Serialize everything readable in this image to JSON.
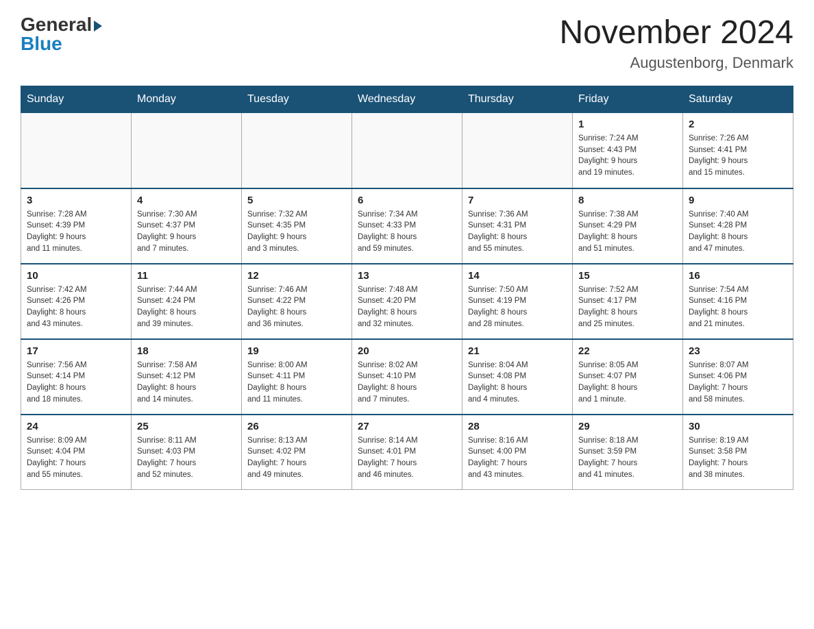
{
  "header": {
    "logo_general": "General",
    "logo_blue": "Blue",
    "month_title": "November 2024",
    "location": "Augustenborg, Denmark"
  },
  "weekdays": [
    "Sunday",
    "Monday",
    "Tuesday",
    "Wednesday",
    "Thursday",
    "Friday",
    "Saturday"
  ],
  "weeks": [
    [
      {
        "day": "",
        "info": ""
      },
      {
        "day": "",
        "info": ""
      },
      {
        "day": "",
        "info": ""
      },
      {
        "day": "",
        "info": ""
      },
      {
        "day": "",
        "info": ""
      },
      {
        "day": "1",
        "info": "Sunrise: 7:24 AM\nSunset: 4:43 PM\nDaylight: 9 hours\nand 19 minutes."
      },
      {
        "day": "2",
        "info": "Sunrise: 7:26 AM\nSunset: 4:41 PM\nDaylight: 9 hours\nand 15 minutes."
      }
    ],
    [
      {
        "day": "3",
        "info": "Sunrise: 7:28 AM\nSunset: 4:39 PM\nDaylight: 9 hours\nand 11 minutes."
      },
      {
        "day": "4",
        "info": "Sunrise: 7:30 AM\nSunset: 4:37 PM\nDaylight: 9 hours\nand 7 minutes."
      },
      {
        "day": "5",
        "info": "Sunrise: 7:32 AM\nSunset: 4:35 PM\nDaylight: 9 hours\nand 3 minutes."
      },
      {
        "day": "6",
        "info": "Sunrise: 7:34 AM\nSunset: 4:33 PM\nDaylight: 8 hours\nand 59 minutes."
      },
      {
        "day": "7",
        "info": "Sunrise: 7:36 AM\nSunset: 4:31 PM\nDaylight: 8 hours\nand 55 minutes."
      },
      {
        "day": "8",
        "info": "Sunrise: 7:38 AM\nSunset: 4:29 PM\nDaylight: 8 hours\nand 51 minutes."
      },
      {
        "day": "9",
        "info": "Sunrise: 7:40 AM\nSunset: 4:28 PM\nDaylight: 8 hours\nand 47 minutes."
      }
    ],
    [
      {
        "day": "10",
        "info": "Sunrise: 7:42 AM\nSunset: 4:26 PM\nDaylight: 8 hours\nand 43 minutes."
      },
      {
        "day": "11",
        "info": "Sunrise: 7:44 AM\nSunset: 4:24 PM\nDaylight: 8 hours\nand 39 minutes."
      },
      {
        "day": "12",
        "info": "Sunrise: 7:46 AM\nSunset: 4:22 PM\nDaylight: 8 hours\nand 36 minutes."
      },
      {
        "day": "13",
        "info": "Sunrise: 7:48 AM\nSunset: 4:20 PM\nDaylight: 8 hours\nand 32 minutes."
      },
      {
        "day": "14",
        "info": "Sunrise: 7:50 AM\nSunset: 4:19 PM\nDaylight: 8 hours\nand 28 minutes."
      },
      {
        "day": "15",
        "info": "Sunrise: 7:52 AM\nSunset: 4:17 PM\nDaylight: 8 hours\nand 25 minutes."
      },
      {
        "day": "16",
        "info": "Sunrise: 7:54 AM\nSunset: 4:16 PM\nDaylight: 8 hours\nand 21 minutes."
      }
    ],
    [
      {
        "day": "17",
        "info": "Sunrise: 7:56 AM\nSunset: 4:14 PM\nDaylight: 8 hours\nand 18 minutes."
      },
      {
        "day": "18",
        "info": "Sunrise: 7:58 AM\nSunset: 4:12 PM\nDaylight: 8 hours\nand 14 minutes."
      },
      {
        "day": "19",
        "info": "Sunrise: 8:00 AM\nSunset: 4:11 PM\nDaylight: 8 hours\nand 11 minutes."
      },
      {
        "day": "20",
        "info": "Sunrise: 8:02 AM\nSunset: 4:10 PM\nDaylight: 8 hours\nand 7 minutes."
      },
      {
        "day": "21",
        "info": "Sunrise: 8:04 AM\nSunset: 4:08 PM\nDaylight: 8 hours\nand 4 minutes."
      },
      {
        "day": "22",
        "info": "Sunrise: 8:05 AM\nSunset: 4:07 PM\nDaylight: 8 hours\nand 1 minute."
      },
      {
        "day": "23",
        "info": "Sunrise: 8:07 AM\nSunset: 4:06 PM\nDaylight: 7 hours\nand 58 minutes."
      }
    ],
    [
      {
        "day": "24",
        "info": "Sunrise: 8:09 AM\nSunset: 4:04 PM\nDaylight: 7 hours\nand 55 minutes."
      },
      {
        "day": "25",
        "info": "Sunrise: 8:11 AM\nSunset: 4:03 PM\nDaylight: 7 hours\nand 52 minutes."
      },
      {
        "day": "26",
        "info": "Sunrise: 8:13 AM\nSunset: 4:02 PM\nDaylight: 7 hours\nand 49 minutes."
      },
      {
        "day": "27",
        "info": "Sunrise: 8:14 AM\nSunset: 4:01 PM\nDaylight: 7 hours\nand 46 minutes."
      },
      {
        "day": "28",
        "info": "Sunrise: 8:16 AM\nSunset: 4:00 PM\nDaylight: 7 hours\nand 43 minutes."
      },
      {
        "day": "29",
        "info": "Sunrise: 8:18 AM\nSunset: 3:59 PM\nDaylight: 7 hours\nand 41 minutes."
      },
      {
        "day": "30",
        "info": "Sunrise: 8:19 AM\nSunset: 3:58 PM\nDaylight: 7 hours\nand 38 minutes."
      }
    ]
  ]
}
